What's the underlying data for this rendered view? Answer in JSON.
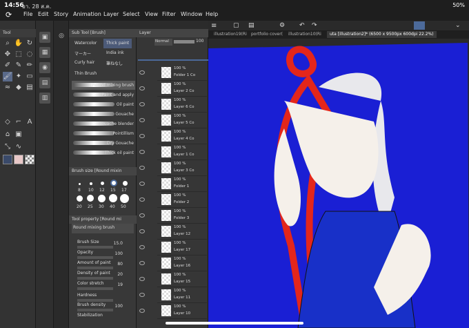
{
  "status": {
    "time": "14:56",
    "date": "อา. 28 ส.ค.",
    "battery": "50%"
  },
  "menu": [
    "File",
    "Edit",
    "Story",
    "Animation",
    "Layer",
    "Select",
    "View",
    "Filter",
    "Window",
    "Help"
  ],
  "tool_panel": {
    "title": "Tool"
  },
  "subtool": {
    "title": "Sub Tool [Brush]",
    "tabs": [
      "Watercolor",
      "Thick paint",
      "マーカー",
      "India ink",
      "Curly hair",
      "筆ねなし",
      "Thin Brush"
    ],
    "brushes": [
      "Round mixing brush",
      "Paint and apply",
      "Oil paint",
      "Gouache",
      "Gouache blender",
      "Pointillism",
      "Dry Gouache",
      "Thick oil paint"
    ],
    "brush_size_title": "Brush size [Round mixin",
    "sizes": [
      "8",
      "10",
      "12",
      "15",
      "17",
      "20",
      "25",
      "30",
      "40",
      "50"
    ],
    "tool_property_title": "Tool property [Round mi",
    "property_brush": "Round mixing brush",
    "properties": [
      {
        "label": "Brush Size",
        "value": "15.0"
      },
      {
        "label": "Opacity",
        "value": "100"
      },
      {
        "label": "Amount of paint",
        "value": "80"
      },
      {
        "label": "Density of paint",
        "value": "20"
      },
      {
        "label": "Color stretch",
        "value": "19"
      },
      {
        "label": "Hardness",
        "value": ""
      },
      {
        "label": "Brush density",
        "value": "100"
      },
      {
        "label": "Stabilization",
        "value": ""
      }
    ]
  },
  "layer_panel": {
    "title": "Layer",
    "blend": "Normal",
    "opacity": "100",
    "layers": [
      {
        "pct": "100 %",
        "name": "Folder 1 Co"
      },
      {
        "pct": "100 %",
        "name": "Layer 2 Co"
      },
      {
        "pct": "100 %",
        "name": "Layer 6 Co"
      },
      {
        "pct": "100 %",
        "name": "Layer 5 Co"
      },
      {
        "pct": "100 %",
        "name": "Layer 4 Co"
      },
      {
        "pct": "100 %",
        "name": "Layer 1 Co"
      },
      {
        "pct": "100 %",
        "name": "Layer 3 Co"
      },
      {
        "pct": "100 %",
        "name": "Folder 1"
      },
      {
        "pct": "100 %",
        "name": "Folder 2"
      },
      {
        "pct": "100 %",
        "name": "Folder 3"
      },
      {
        "pct": "100 %",
        "name": "Layer 12"
      },
      {
        "pct": "100 %",
        "name": "Layer 17"
      },
      {
        "pct": "100 %",
        "name": "Layer 16"
      },
      {
        "pct": "100 %",
        "name": "Layer 15"
      },
      {
        "pct": "100 %",
        "name": "Layer 11"
      },
      {
        "pct": "100 %",
        "name": "Layer 10"
      }
    ]
  },
  "tabs": [
    "illustration19(Ri",
    "portfolio cover(",
    "illustration10(Ri",
    "uta [illustration2]* (6500 x 9500px 600dpi 22.2%)"
  ],
  "colors": {
    "canvas_bg": "#1a1fd4",
    "hair_red": "#e3261b",
    "hair_white": "#e8e8ec",
    "skin": "#f5f0ea",
    "main_color": "#e8c8c8"
  }
}
